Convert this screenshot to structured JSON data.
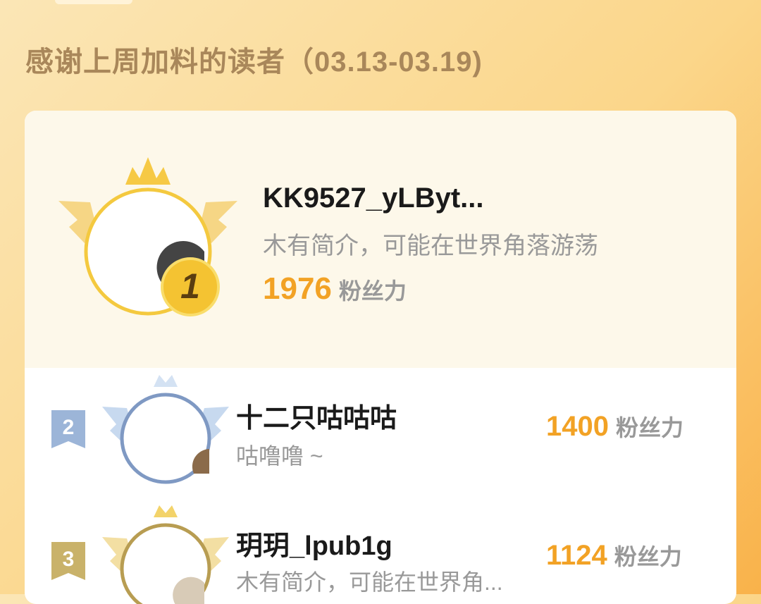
{
  "header": {
    "title": "感谢上周加料的读者（03.13-03.19)"
  },
  "leaders": [
    {
      "rank": "1",
      "name": "KK9527_yLByt...",
      "bio": "木有简介，可能在世界角落游荡",
      "score": "1976",
      "unit": "粉丝力"
    },
    {
      "rank": "2",
      "name": "十二只咕咕咕",
      "bio": "咕噜噜 ~",
      "score": "1400",
      "unit": "粉丝力"
    },
    {
      "rank": "3",
      "name": "玥玥_lpub1g",
      "bio": "木有简介，可能在世界角...",
      "score": "1124",
      "unit": "粉丝力"
    }
  ],
  "colors": {
    "gold": "#f2a225",
    "silver": "#8ea9cf",
    "bronze": "#c9b26a",
    "title": "#a9875a"
  }
}
